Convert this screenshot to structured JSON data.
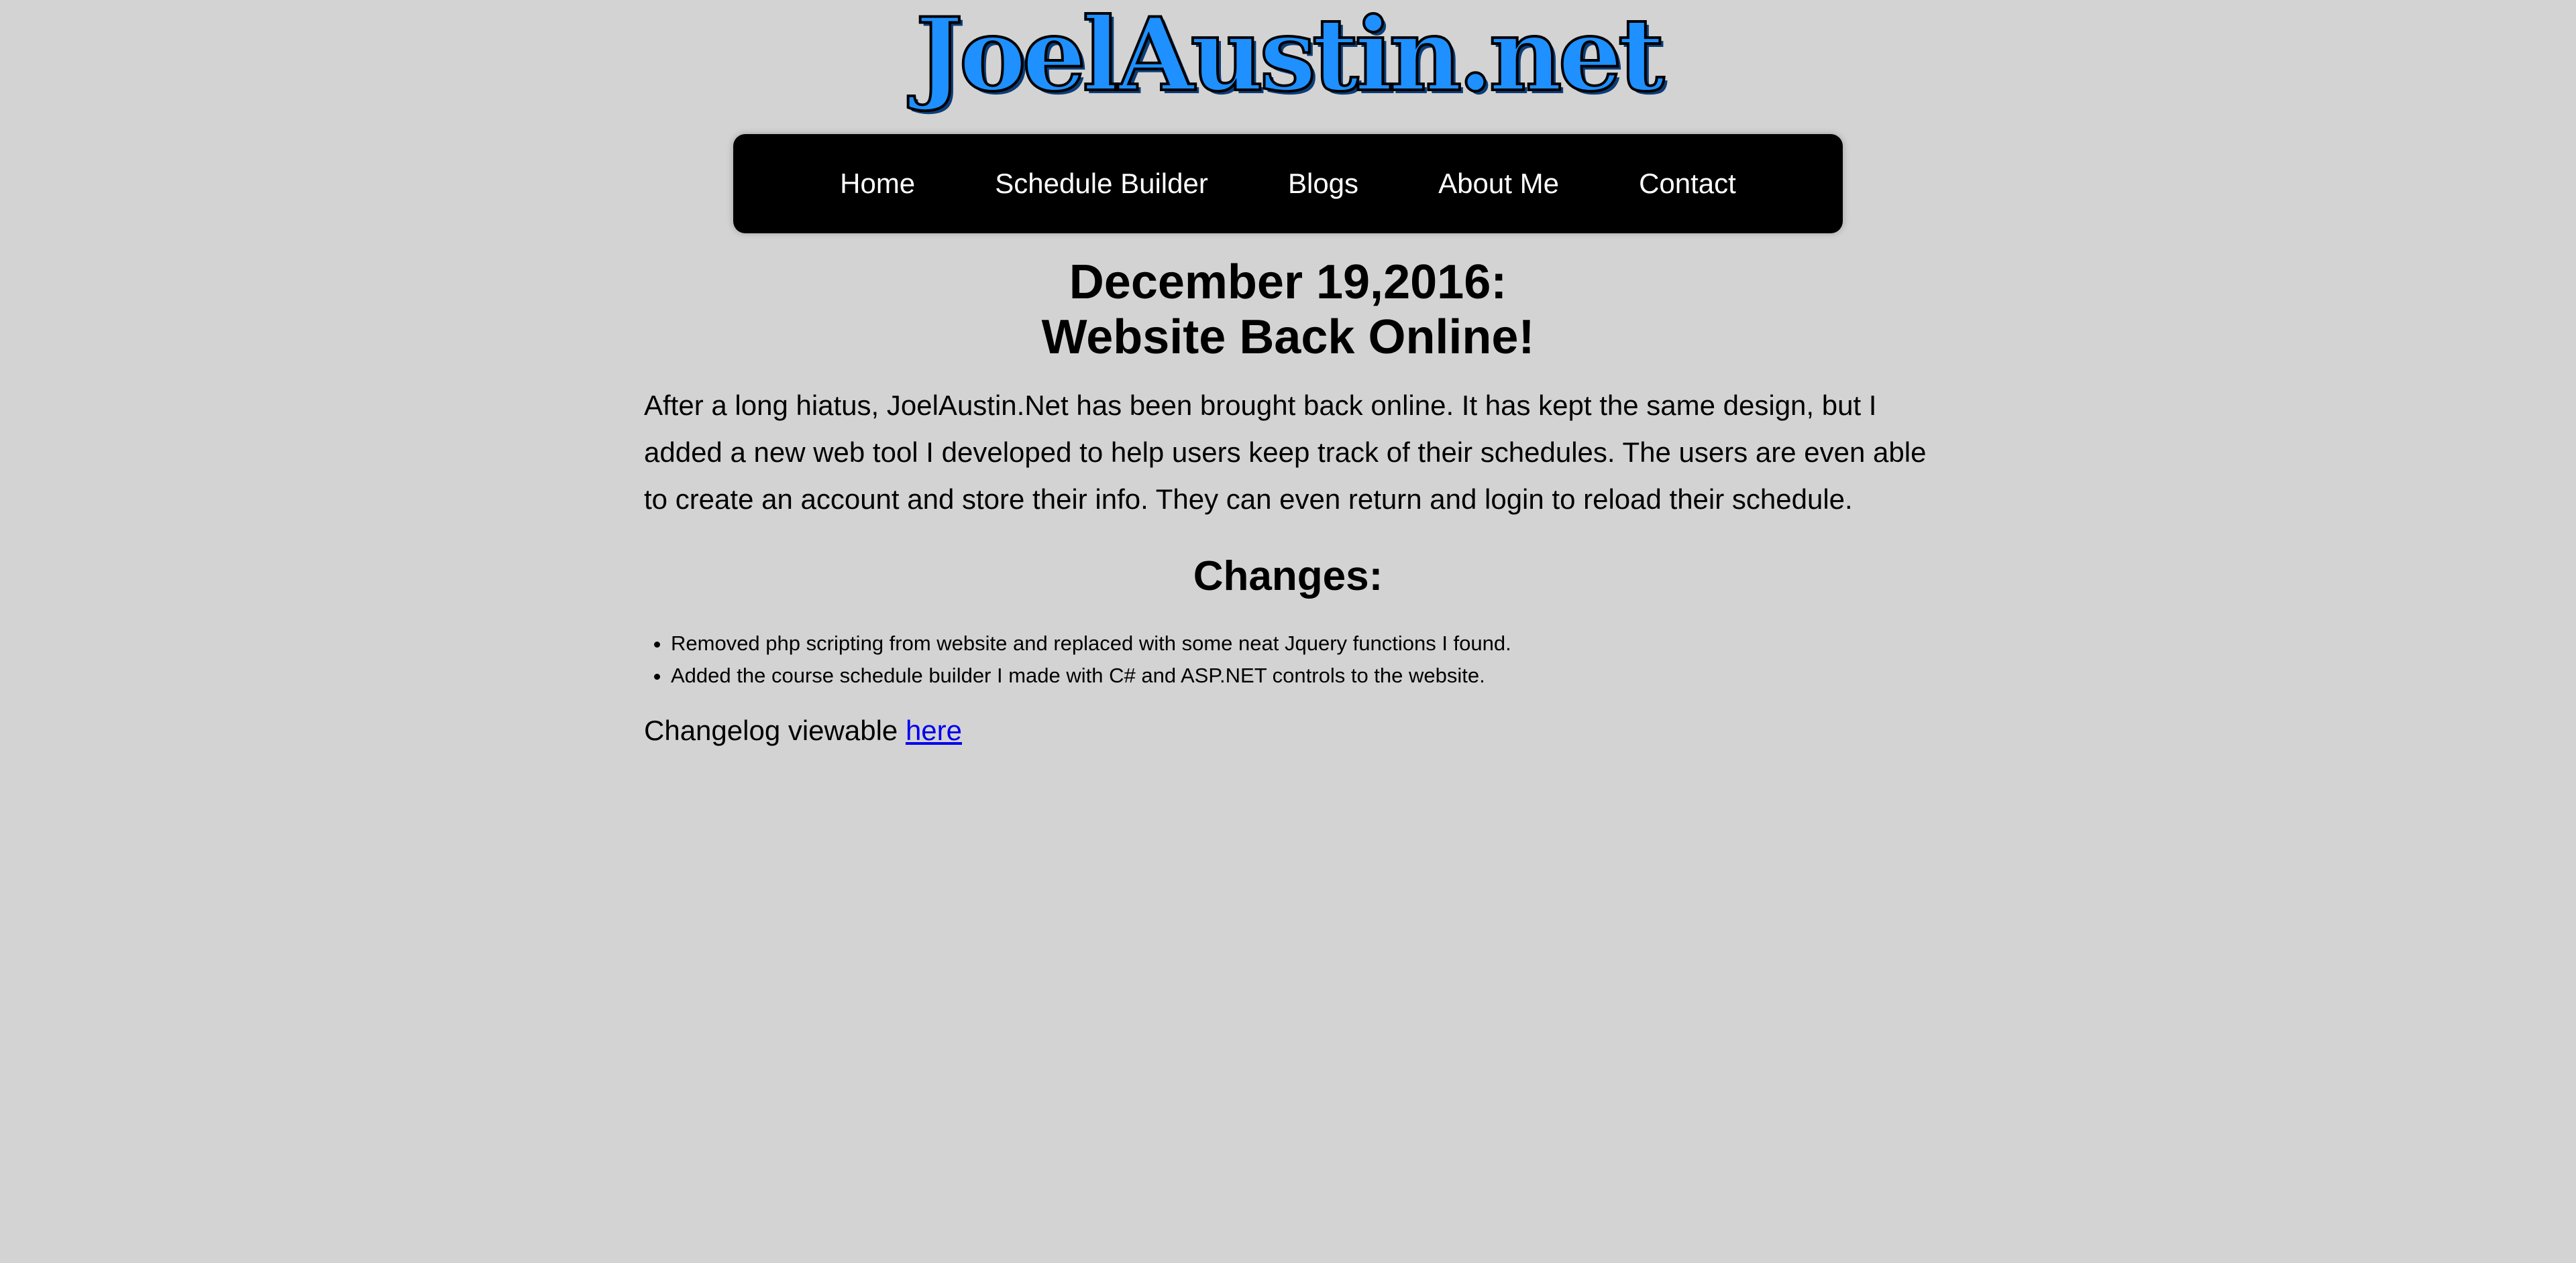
{
  "site": {
    "title": "JoelAustin.net",
    "title_color": "#1e90ff"
  },
  "nav": {
    "items": [
      {
        "label": "Home"
      },
      {
        "label": "Schedule Builder"
      },
      {
        "label": "Blogs"
      },
      {
        "label": "About Me"
      },
      {
        "label": "Contact"
      }
    ]
  },
  "post": {
    "title_line1": "December 19,2016:",
    "title_line2": "Website Back Online!",
    "body": "After a long hiatus, JoelAustin.Net has been brought back online. It has kept the same design, but I added a new web tool I developed to help users keep track of their schedules. The users are even able to create an account and store their info. They can even return and login to reload their schedule.",
    "changes_heading": "Changes:",
    "changes": [
      "Removed php scripting from website and replaced with some neat Jquery functions I found.",
      "Added the course schedule builder I made with C# and ASP.NET controls to the website."
    ],
    "changelog_prefix": "Changelog viewable ",
    "changelog_link": "here"
  },
  "colors": {
    "background": "#d3d3d3",
    "nav_background": "#000000",
    "link": "#0000ee"
  }
}
